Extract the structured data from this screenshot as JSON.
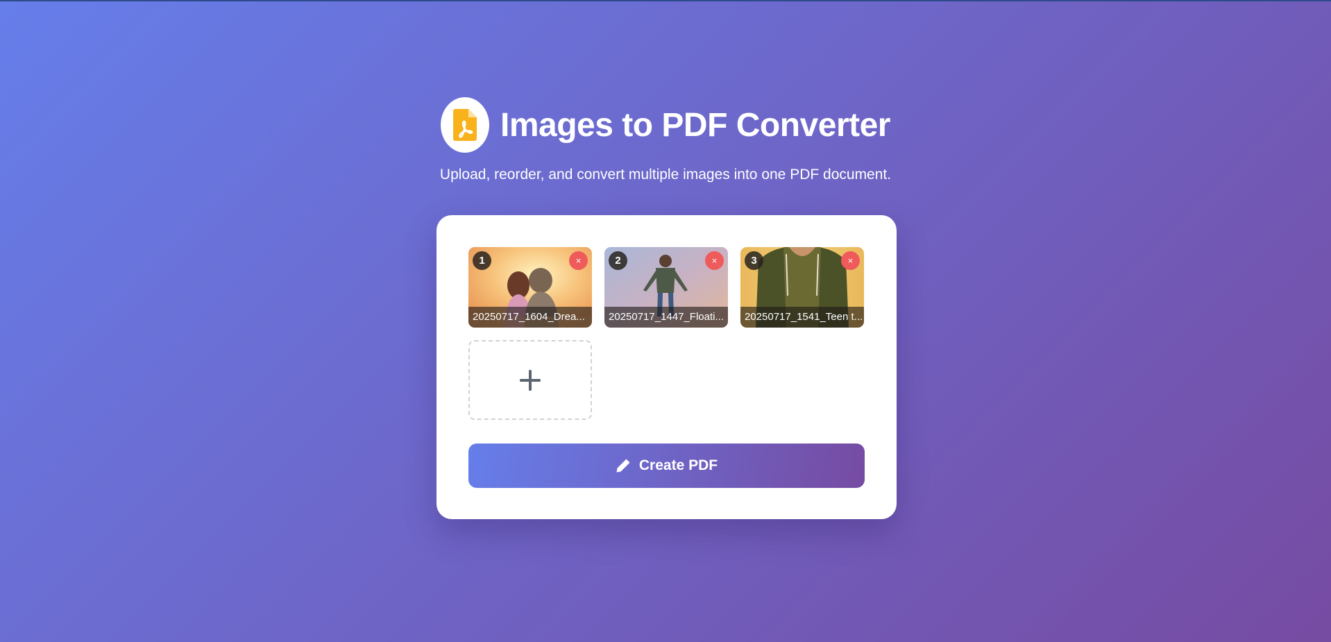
{
  "header": {
    "title": "Images to PDF Converter",
    "subtitle": "Upload, reorder, and convert multiple images into one PDF document.",
    "logo_icon": "pdf-file-icon"
  },
  "images": [
    {
      "number": "1",
      "filename": "20250717_1604_Drea...",
      "remove_label": "×"
    },
    {
      "number": "2",
      "filename": "20250717_1447_Floati...",
      "remove_label": "×"
    },
    {
      "number": "3",
      "filename": "20250717_1541_Teen t...",
      "remove_label": "×"
    }
  ],
  "add_tile": {
    "icon": "plus-icon"
  },
  "create_button": {
    "label": "Create PDF",
    "icon": "pencil-icon"
  },
  "colors": {
    "gradient_start": "#667eea",
    "gradient_end": "#764ba2",
    "remove_red": "#ef5a5a",
    "logo_yellow": "#f9b21c"
  }
}
